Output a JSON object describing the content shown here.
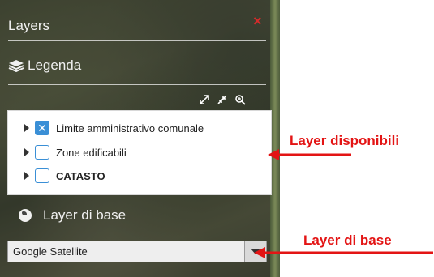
{
  "panel": {
    "title": "Layers",
    "close_symbol": "×",
    "legend_label": "Legenda",
    "base_layer_label": "Layer di base"
  },
  "layers": [
    {
      "label": "Limite amministrativo comunale",
      "checked": true,
      "bold": false
    },
    {
      "label": "Zone edificabili",
      "checked": false,
      "bold": false
    },
    {
      "label": "CATASTO",
      "checked": false,
      "bold": true
    }
  ],
  "base_select": {
    "value": "Google Satellite"
  },
  "annotations": {
    "layers_available": "Layer disponibili",
    "base_layer": "Layer di base"
  },
  "colors": {
    "accent": "#3a8fd6",
    "annotation": "#e31414",
    "close": "#d42b2b"
  },
  "icons": {
    "legend": "layers-stack-icon",
    "expand": "expand-icon",
    "collapse": "collapse-icon",
    "zoom": "zoom-icon",
    "globe": "globe-icon"
  }
}
